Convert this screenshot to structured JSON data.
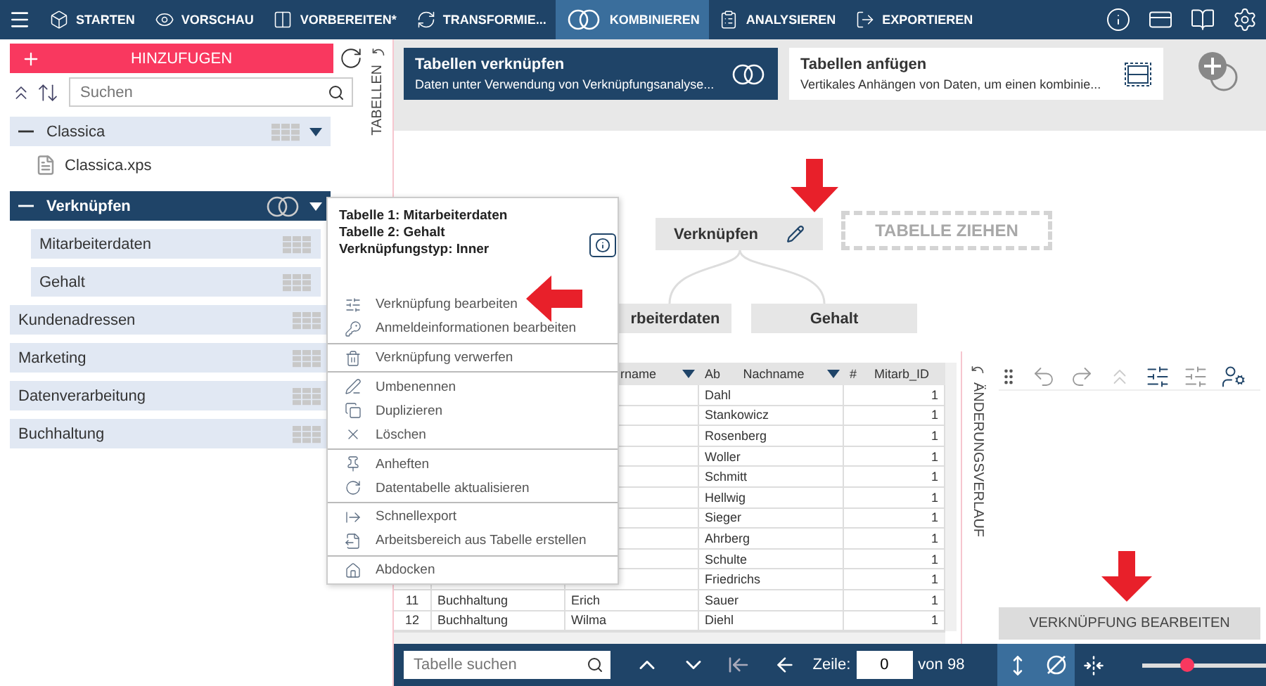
{
  "nav": {
    "items": [
      {
        "label": "STARTEN",
        "selected": false
      },
      {
        "label": "VORSCHAU",
        "selected": false
      },
      {
        "label": "VORBEREITEN*",
        "selected": false
      },
      {
        "label": "TRANSFORMIE...",
        "selected": false
      },
      {
        "label": "KOMBINIEREN",
        "selected": true
      },
      {
        "label": "ANALYSIEREN",
        "selected": false
      },
      {
        "label": "EXPORTIEREN",
        "selected": false
      }
    ]
  },
  "sidebar": {
    "add_button": "HINZUFUGEN",
    "search": {
      "placeholder": "Suchen"
    },
    "strip_label": "TABELLEN",
    "tree": [
      {
        "kind": "group",
        "label": "Classica",
        "expanded": true,
        "selected": false,
        "children": [
          {
            "kind": "file",
            "label": "Classica.xps"
          }
        ]
      },
      {
        "kind": "join",
        "label": "Verknüpfen",
        "expanded": true,
        "selected": true,
        "children": [
          {
            "kind": "table",
            "label": "Mitarbeiterdaten"
          },
          {
            "kind": "table",
            "label": "Gehalt"
          }
        ]
      },
      {
        "kind": "table",
        "label": "Kundenadressen",
        "selected": false
      },
      {
        "kind": "table",
        "label": "Marketing",
        "selected": false
      },
      {
        "kind": "table",
        "label": "Datenverarbeitung",
        "selected": false
      },
      {
        "kind": "table",
        "label": "Buchhaltung",
        "selected": false
      }
    ]
  },
  "cards": [
    {
      "title": "Tabellen verknüpfen",
      "subtitle": "Daten unter Verwendung von Verknüpfungsanalyse...",
      "selected": true
    },
    {
      "title": "Tabellen anfügen",
      "subtitle": "Vertikales Anhängen von Daten, um einen kombinie...",
      "selected": false
    }
  ],
  "diagram": {
    "root": "Verknüpfen",
    "drop_target": "TABELLE ZIEHEN",
    "children": [
      "rbeiterdaten",
      "Gehalt"
    ]
  },
  "context_menu": {
    "info": [
      "Tabelle 1: Mitarbeiterdaten",
      "Tabelle 2: Gehalt",
      "Verknüpfungstyp: Inner"
    ],
    "groups": [
      [
        "Verknüpfung bearbeiten",
        "Anmeldeinformationen bearbeiten"
      ],
      [
        "Verknüpfung verwerfen"
      ],
      [
        "Umbenennen",
        "Duplizieren",
        "Löschen"
      ],
      [
        "Anheften",
        "Datentabelle aktualisieren"
      ],
      [
        "Schnellexport",
        "Arbeitsbereich aus Tabelle erstellen"
      ],
      [
        "Abdocken"
      ]
    ]
  },
  "table": {
    "columns": [
      {
        "label": "rname",
        "filter": true
      },
      {
        "type_label": "Ab",
        "label": "Nachname",
        "filter": true
      },
      {
        "type_label": "#",
        "label": "Mitarb_ID",
        "filter": false
      }
    ],
    "rows": [
      {
        "nachname": "Dahl",
        "mitarb_id": "1"
      },
      {
        "nachname": "Stankowicz",
        "mitarb_id": "1"
      },
      {
        "nachname": "Rosenberg",
        "mitarb_id": "1"
      },
      {
        "nachname": "Woller",
        "mitarb_id": "1"
      },
      {
        "nachname": "Schmitt",
        "mitarb_id": "1"
      },
      {
        "nachname": "Hellwig",
        "mitarb_id": "1"
      },
      {
        "nachname": "Sieger",
        "mitarb_id": "1"
      },
      {
        "nachname": "Ahrberg",
        "mitarb_id": "1"
      },
      {
        "nachname": "Schulte",
        "mitarb_id": "1"
      },
      {
        "nachname": "Friedrichs",
        "mitarb_id": "1"
      },
      {
        "nr": "11",
        "abteilung": "Buchhaltung",
        "vorname": "Erich",
        "nachname": "Sauer",
        "mitarb_id": "1"
      },
      {
        "nr": "12",
        "abteilung": "Buchhaltung",
        "vorname": "Wilma",
        "nachname": "Diehl",
        "mitarb_id": "1"
      }
    ]
  },
  "history": {
    "strip_label": "ÄNDERUNGSVERLAUF",
    "button": "VERKNÜPFUNG BEARBEITEN"
  },
  "bottom_bar": {
    "search": {
      "placeholder": "Tabelle suchen"
    },
    "row_label": "Zeile:",
    "row_value": "0",
    "row_total": "von 98",
    "toggles": [
      {
        "selected": true
      },
      {
        "selected": true
      },
      {
        "selected": false
      }
    ],
    "zoom": {
      "level": 0.37
    }
  }
}
